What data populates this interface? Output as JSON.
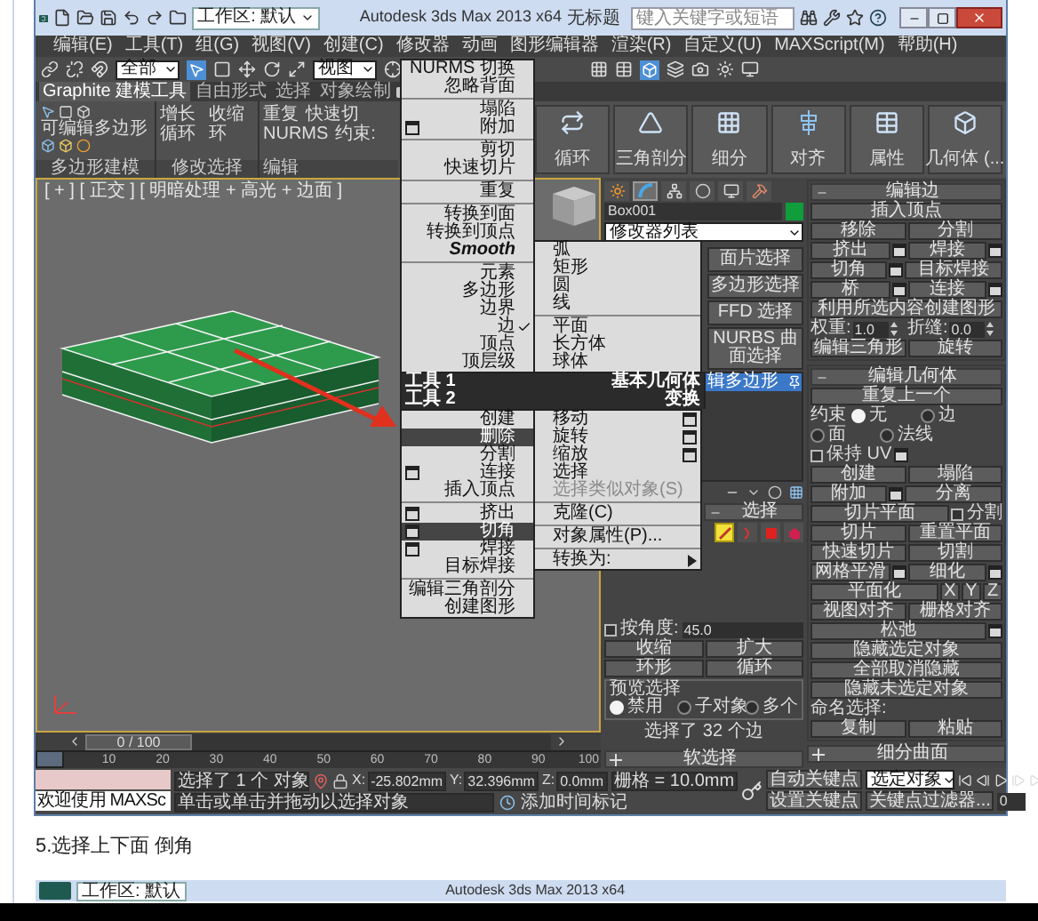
{
  "title_bar": {
    "workspace": "工作区: 默认",
    "title": "Autodesk 3ds Max  2013 x64",
    "document": "无标题",
    "search": {
      "placeholder": "键入关键字或短语"
    }
  },
  "menu_bar": [
    "编辑(E)",
    "工具(T)",
    "组(G)",
    "视图(V)",
    "创建(C)",
    "修改器",
    "动画",
    "图形编辑器",
    "渲染(R)",
    "自定义(U)",
    "MAXScript(M)",
    "帮助(H)"
  ],
  "toolbar": {
    "selection_filter": "全部",
    "reference_coordinate": "视图"
  },
  "ribbon": {
    "tabs": [
      {
        "label": "Graphite 建模工具",
        "selected": true
      },
      {
        "label": "自由形式",
        "selected": false
      },
      {
        "label": "选择",
        "selected": false
      },
      {
        "label": "对象绘制",
        "selected": false
      }
    ],
    "polygon_modeling": {
      "object": "可编辑多边形",
      "label": "多边形建模"
    },
    "modify_selection": {
      "items": [
        "增长",
        "收缩",
        "循环",
        "环"
      ],
      "label": "修改选择"
    },
    "edit": {
      "items": [
        "重复",
        "快速切",
        "NURMS",
        "约束:"
      ],
      "label": "编辑"
    },
    "tools": [
      {
        "kind": "loop",
        "label": "循环"
      },
      {
        "kind": "triangulate",
        "label": "三角剖分"
      },
      {
        "kind": "subdivide",
        "label": "细分"
      },
      {
        "kind": "align",
        "label": "对齐"
      },
      {
        "kind": "properties",
        "label": "属性"
      },
      {
        "kind": "geometry",
        "label": "几何体 (..."
      }
    ]
  },
  "viewport": {
    "label": "[ + ] [ 正交 ] [ 明暗处理 + 高光 + 边面 ]"
  },
  "quad_menu": {
    "top_left": [
      [
        {
          "label": "NURMS 切换",
          "kind": "plain",
          "selected": false,
          "checked": false,
          "disabled": false
        },
        {
          "label": "忽略背面",
          "kind": "plain",
          "selected": false,
          "checked": false,
          "disabled": false
        }
      ],
      [
        {
          "label": "塌陷",
          "kind": "plain",
          "selected": false,
          "checked": false,
          "disabled": false
        },
        {
          "label": "附加",
          "kind": "box",
          "selected": false,
          "checked": false,
          "disabled": false
        }
      ],
      [
        {
          "label": "剪切",
          "kind": "plain",
          "selected": false,
          "checked": false,
          "disabled": false
        },
        {
          "label": "快速切片",
          "kind": "plain",
          "selected": false,
          "checked": false,
          "disabled": false
        }
      ],
      [
        {
          "label": "重复",
          "kind": "plain",
          "selected": false,
          "checked": false,
          "disabled": false
        }
      ],
      [
        {
          "label": "转换到面",
          "kind": "plain",
          "selected": false,
          "checked": false,
          "disabled": false
        },
        {
          "label": "转换到顶点",
          "kind": "plain",
          "selected": false,
          "checked": false,
          "disabled": false
        },
        {
          "label": "Smooth",
          "kind": "emphasis",
          "selected": false,
          "checked": false,
          "disabled": false
        }
      ],
      [
        {
          "label": "元素",
          "kind": "plain",
          "selected": false,
          "checked": false,
          "disabled": false
        },
        {
          "label": "多边形",
          "kind": "plain",
          "selected": false,
          "checked": false,
          "disabled": false
        },
        {
          "label": "边界",
          "kind": "plain",
          "selected": false,
          "checked": false,
          "disabled": false
        },
        {
          "label": "边",
          "kind": "plain",
          "selected": false,
          "checked": true,
          "disabled": false
        },
        {
          "label": "顶点",
          "kind": "plain",
          "selected": false,
          "checked": false,
          "disabled": false
        },
        {
          "label": "顶层级",
          "kind": "plain",
          "selected": false,
          "checked": false,
          "disabled": false
        }
      ]
    ],
    "top_right": [
      [
        {
          "label": "弧",
          "kind": "plain",
          "selected": false,
          "checked": false,
          "disabled": false
        },
        {
          "label": "矩形",
          "kind": "plain",
          "selected": false,
          "checked": false,
          "disabled": false
        },
        {
          "label": "圆",
          "kind": "plain",
          "selected": false,
          "checked": false,
          "disabled": false
        },
        {
          "label": "线",
          "kind": "plain",
          "selected": false,
          "checked": false,
          "disabled": false
        }
      ],
      [
        {
          "label": "平面",
          "kind": "plain",
          "selected": false,
          "checked": false,
          "disabled": false
        },
        {
          "label": "长方体",
          "kind": "plain",
          "selected": false,
          "checked": false,
          "disabled": false
        },
        {
          "label": "球体",
          "kind": "plain",
          "selected": false,
          "checked": false,
          "disabled": false
        }
      ]
    ],
    "headers": [
      {
        "left": "工具 1",
        "right": "基本几何体"
      },
      {
        "left": "工具 2",
        "right": "变换"
      }
    ],
    "bottom_left": [
      [
        {
          "label": "创建",
          "kind": "plain",
          "selected": false,
          "checked": false,
          "disabled": false
        },
        {
          "label": "删除",
          "kind": "plain",
          "selected": true,
          "checked": false,
          "disabled": false
        },
        {
          "label": "分割",
          "kind": "plain",
          "selected": false,
          "checked": false,
          "disabled": false
        },
        {
          "label": "连接",
          "kind": "box",
          "selected": false,
          "checked": false,
          "disabled": false
        },
        {
          "label": "插入顶点",
          "kind": "plain",
          "selected": false,
          "checked": false,
          "disabled": false
        }
      ],
      [
        {
          "label": "挤出",
          "kind": "box",
          "selected": false,
          "checked": false,
          "disabled": false
        },
        {
          "label": "切角",
          "kind": "box",
          "selected": true,
          "checked": false,
          "disabled": false
        },
        {
          "label": "焊接",
          "kind": "box",
          "selected": false,
          "checked": false,
          "disabled": false
        },
        {
          "label": "目标焊接",
          "kind": "plain",
          "selected": false,
          "checked": false,
          "disabled": false
        }
      ],
      [
        {
          "label": "编辑三角剖分",
          "kind": "plain",
          "selected": false,
          "checked": false,
          "disabled": false
        },
        {
          "label": "创建图形",
          "kind": "plain",
          "selected": false,
          "checked": false,
          "disabled": false
        }
      ]
    ],
    "bottom_right": [
      [
        {
          "label": "移动",
          "kind": "box",
          "selected": false,
          "checked": false,
          "disabled": false
        },
        {
          "label": "旋转",
          "kind": "box",
          "selected": false,
          "checked": false,
          "disabled": false
        },
        {
          "label": "缩放",
          "kind": "box",
          "selected": false,
          "checked": false,
          "disabled": false
        },
        {
          "label": "选择",
          "kind": "plain",
          "selected": false,
          "checked": false,
          "disabled": false
        },
        {
          "label": "选择类似对象(S)",
          "kind": "plain",
          "selected": false,
          "checked": false,
          "disabled": true
        }
      ],
      [
        {
          "label": "克隆(C)",
          "kind": "plain",
          "selected": false,
          "checked": false,
          "disabled": false
        }
      ],
      [
        {
          "label": "对象属性(P)...",
          "kind": "plain",
          "selected": false,
          "checked": false,
          "disabled": false
        }
      ],
      [
        {
          "label": "转换为:",
          "kind": "submenu",
          "selected": false,
          "checked": false,
          "disabled": false
        }
      ]
    ]
  },
  "command_panel": {
    "tabs": [
      {
        "kind": "create",
        "selected": false
      },
      {
        "kind": "modify",
        "selected": true
      },
      {
        "kind": "hierarchy",
        "selected": false
      },
      {
        "kind": "motion",
        "selected": false
      },
      {
        "kind": "display",
        "selected": false
      },
      {
        "kind": "utilities",
        "selected": false
      }
    ],
    "object_name": "Box001",
    "modifier_list": "修改器列表",
    "modifier_buttons": [
      "面片选择",
      "多边形选择",
      "FFD 选择",
      "NURBS 曲面选择"
    ],
    "stack": [
      {
        "label": "辑多边形",
        "selected": true
      }
    ],
    "selection": {
      "title": "选择",
      "expanded": true,
      "levels": [
        {
          "kind": "edge",
          "selected": true
        },
        {
          "kind": "border",
          "selected": false
        },
        {
          "kind": "polygon",
          "selected": false
        },
        {
          "kind": "element",
          "selected": false
        }
      ],
      "by_angle": {
        "label": "按角度:",
        "checked": false,
        "value": "45.0"
      },
      "shrink": "收缩",
      "grow": "扩大",
      "ring": "环形",
      "loop": "循环",
      "preview": {
        "title": "预览选择",
        "options": [
          {
            "label": "禁用",
            "selected": true
          },
          {
            "label": "子对象",
            "selected": false
          },
          {
            "label": "多个",
            "selected": false
          }
        ]
      },
      "status": "选择了 32 个边"
    },
    "soft_selection": {
      "title": "软选择",
      "expanded": false
    },
    "edit_edges": {
      "title": "编辑边",
      "expanded": true,
      "rows": [
        {
          "items": [
            {
              "kind": "button",
              "label": "插入顶点"
            }
          ]
        },
        {
          "items": [
            {
              "kind": "button",
              "label": "移除"
            },
            {
              "kind": "button",
              "label": "分割"
            }
          ]
        },
        {
          "items": [
            {
              "kind": "setting",
              "label": "挤出"
            },
            {
              "kind": "setting",
              "label": "焊接"
            }
          ]
        },
        {
          "items": [
            {
              "kind": "setting",
              "label": "切角"
            },
            {
              "kind": "button",
              "label": "目标焊接"
            }
          ]
        },
        {
          "items": [
            {
              "kind": "setting",
              "label": "桥"
            },
            {
              "kind": "setting",
              "label": "连接"
            }
          ]
        },
        {
          "items": [
            {
              "kind": "button",
              "label": "利用所选内容创建图形"
            }
          ]
        },
        {
          "items": [
            {
              "kind": "spinner",
              "label": "权重:",
              "value": "1.0"
            },
            {
              "kind": "spinner",
              "label": "折缝:",
              "value": "0.0"
            }
          ]
        },
        {
          "items": [
            {
              "kind": "button",
              "label": "编辑三角形"
            },
            {
              "kind": "button",
              "label": "旋转"
            }
          ]
        }
      ]
    },
    "edit_geometry": {
      "title": "编辑几何体",
      "expanded": true,
      "rows": [
        {
          "items": [
            {
              "kind": "button",
              "label": "重复上一个"
            }
          ]
        },
        {
          "items": [
            {
              "kind": "text",
              "label": "约束"
            },
            {
              "kind": "radio",
              "label": "无",
              "selected": true
            },
            {
              "kind": "radio",
              "label": "边",
              "selected": false
            }
          ]
        },
        {
          "items": [
            {
              "kind": "radio",
              "label": "面",
              "selected": false
            },
            {
              "kind": "radio",
              "label": "法线",
              "selected": false
            }
          ]
        },
        {
          "items": [
            {
              "kind": "check",
              "label": "保持 UV",
              "checked": false
            },
            {
              "kind": "box"
            }
          ]
        },
        {
          "items": [
            {
              "kind": "button",
              "label": "创建"
            },
            {
              "kind": "button",
              "label": "塌陷"
            }
          ]
        },
        {
          "items": [
            {
              "kind": "setting",
              "label": "附加"
            },
            {
              "kind": "button",
              "label": "分离"
            }
          ]
        },
        {
          "items": [
            {
              "kind": "button",
              "label": "切片平面"
            },
            {
              "kind": "check",
              "label": "分割",
              "checked": false
            }
          ]
        },
        {
          "items": [
            {
              "kind": "button",
              "label": "切片"
            },
            {
              "kind": "button",
              "label": "重置平面"
            }
          ]
        },
        {
          "items": [
            {
              "kind": "button",
              "label": "快速切片"
            },
            {
              "kind": "button",
              "label": "切割"
            }
          ]
        },
        {
          "items": [
            {
              "kind": "setting",
              "label": "网格平滑"
            },
            {
              "kind": "setting",
              "label": "细化"
            }
          ]
        },
        {
          "items": [
            {
              "kind": "button",
              "label": "平面化"
            },
            {
              "kind": "axis",
              "label": "X"
            },
            {
              "kind": "axis",
              "label": "Y"
            },
            {
              "kind": "axis",
              "label": "Z"
            }
          ]
        },
        {
          "items": [
            {
              "kind": "button",
              "label": "视图对齐"
            },
            {
              "kind": "button",
              "label": "栅格对齐"
            }
          ]
        },
        {
          "items": [
            {
              "kind": "setting",
              "label": "松弛"
            }
          ]
        },
        {
          "items": [
            {
              "kind": "button",
              "label": "隐藏选定对象"
            }
          ]
        },
        {
          "items": [
            {
              "kind": "button",
              "label": "全部取消隐藏"
            }
          ]
        },
        {
          "items": [
            {
              "kind": "button",
              "label": "隐藏未选定对象"
            }
          ]
        },
        {
          "items": [
            {
              "kind": "text",
              "label": "命名选择:"
            }
          ]
        },
        {
          "items": [
            {
              "kind": "button",
              "label": "复制"
            },
            {
              "kind": "button",
              "label": "粘贴"
            }
          ]
        }
      ]
    },
    "subdivision": {
      "title": "细分曲面",
      "expanded": false
    }
  },
  "time_slider": {
    "position": "0 / 100",
    "level": 0,
    "ticks": [
      "10",
      "20",
      "30",
      "40",
      "50",
      "60",
      "70",
      "80",
      "90",
      "100"
    ]
  },
  "status_bar": {
    "script_listener": "欢迎使用 MAXSc",
    "selection_info": "选择了 1 个 对象",
    "prompt": "单击或单击并拖动以选择对象",
    "coords": [
      {
        "label": "X:",
        "value": "-25.802mm"
      },
      {
        "label": "Y:",
        "value": "32.396mm"
      },
      {
        "label": "Z:",
        "value": "0.0mm"
      }
    ],
    "grid": "栅格 = 10.0mm",
    "add_time_tag": "添加时间标记",
    "auto_key": "自动关键点",
    "key_mode": "选定对象",
    "set_key": "设置关键点",
    "key_filters": "关键点过滤器...",
    "frame": "0"
  },
  "article": {
    "caption": "5.选择上下面 倒角",
    "next_window": {
      "workspace": "工作区: 默认",
      "title": "Autodesk 3ds Max 2013 x64"
    }
  }
}
